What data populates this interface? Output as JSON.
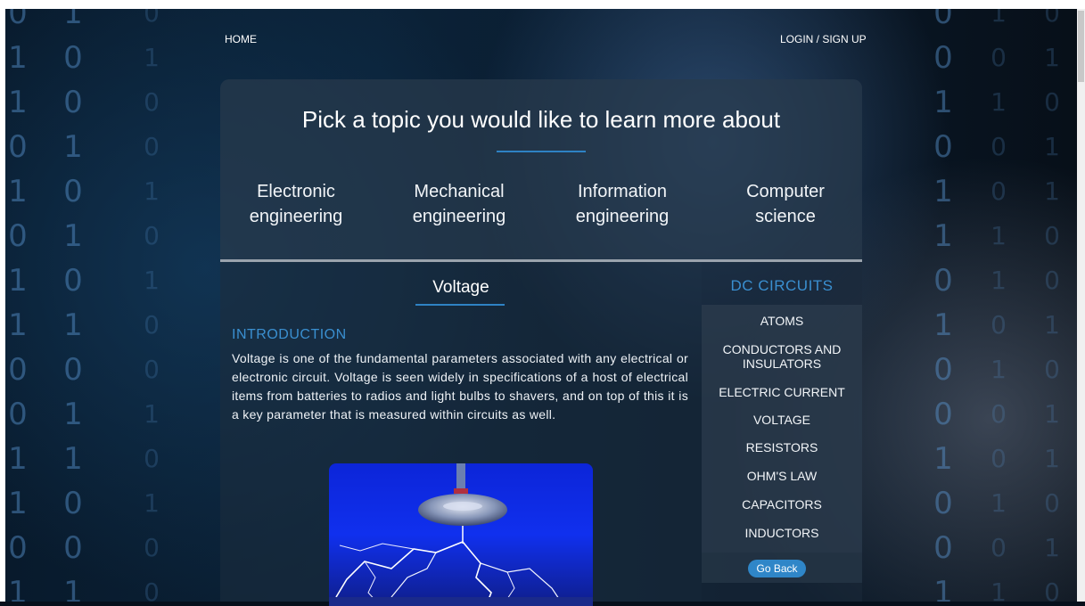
{
  "nav": {
    "home": "HOME",
    "login": "LOGIN / SIGN UP"
  },
  "topics_panel": {
    "title": "Pick a topic you would like to learn more about",
    "topics": [
      {
        "line1": "Electronic",
        "line2": "engineering"
      },
      {
        "line1": "Mechanical",
        "line2": "engineering"
      },
      {
        "line1": "Information",
        "line2": "engineering"
      },
      {
        "line1": "Computer",
        "line2": "science"
      }
    ]
  },
  "article": {
    "heading": "Voltage",
    "section_title": "INTRODUCTION",
    "paragraph": "Voltage is one of the fundamental parameters associated with any electrical or electronic circuit. Voltage is seen widely in specifications of a host of electrical items from batteries to radios and light bulbs to shavers, and on top of this it is a key parameter that is measured within circuits as well."
  },
  "sidebar": {
    "title": "DC CIRCUITS",
    "items": [
      {
        "label": "ATOMS"
      },
      {
        "label": "CONDUCTORS AND INSULATORS"
      },
      {
        "label": "ELECTRIC CURRENT"
      },
      {
        "label": "VOLTAGE"
      },
      {
        "label": "RESISTORS"
      },
      {
        "label": "OHM'S LAW"
      },
      {
        "label": "CAPACITORS"
      },
      {
        "label": "INDUCTORS"
      }
    ],
    "back_button": "Go Back"
  },
  "colors": {
    "accent": "#3a8fd0",
    "button": "#2f86c8"
  }
}
